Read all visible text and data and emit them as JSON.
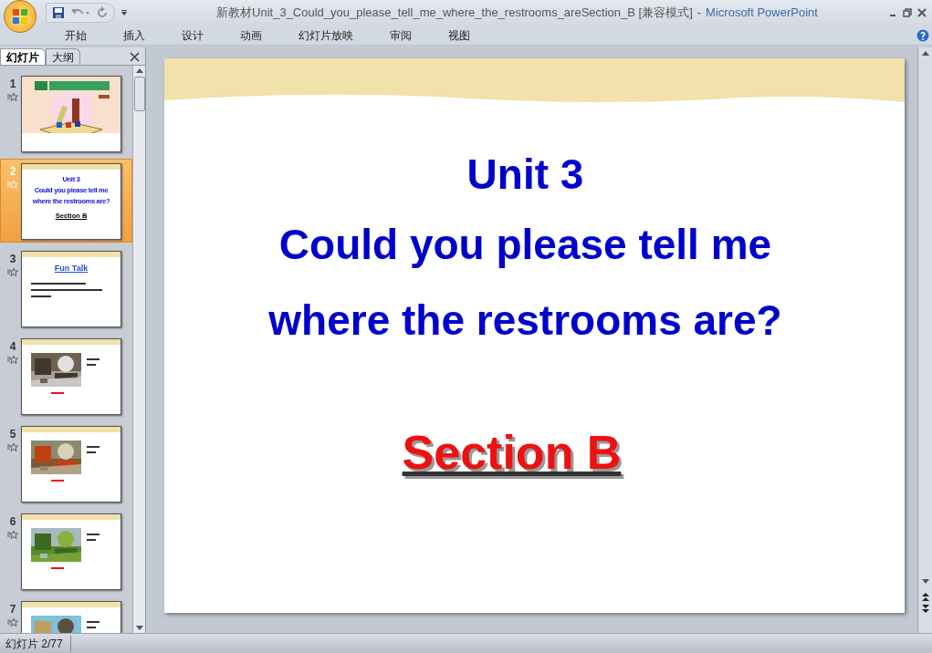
{
  "window": {
    "title": "新教材Unit_3_Could_you_please_tell_me_where_the_restrooms_areSection_B [兼容模式]",
    "separator": "-",
    "app_name": "Microsoft PowerPoint"
  },
  "ribbon_tabs": [
    {
      "label": "开始"
    },
    {
      "label": "插入"
    },
    {
      "label": "设计"
    },
    {
      "label": "动画"
    },
    {
      "label": "幻灯片放映"
    },
    {
      "label": "审阅"
    },
    {
      "label": "视图"
    }
  ],
  "panel_tabs": [
    {
      "label": "幻灯片",
      "selected": true
    },
    {
      "label": "大纲",
      "selected": false
    }
  ],
  "thumbnails": [
    {
      "number": "1",
      "selected": false,
      "kind": "cover"
    },
    {
      "number": "2",
      "selected": true,
      "kind": "text",
      "lines": [
        "Unit 3",
        "Could you please tell me",
        "where the restrooms are?"
      ],
      "footer": "Section B"
    },
    {
      "number": "3",
      "selected": false,
      "kind": "text",
      "heading": "Fun Talk"
    },
    {
      "number": "4",
      "selected": false
    },
    {
      "number": "5",
      "selected": false
    },
    {
      "number": "6",
      "selected": false
    },
    {
      "number": "7",
      "selected": false
    }
  ],
  "slide": {
    "lines": [
      "Unit 3",
      "Could you please tell me",
      "where the restrooms are?"
    ],
    "section": "Section B"
  },
  "status_bar": {
    "slide_counter": "幻灯片 2/77"
  }
}
